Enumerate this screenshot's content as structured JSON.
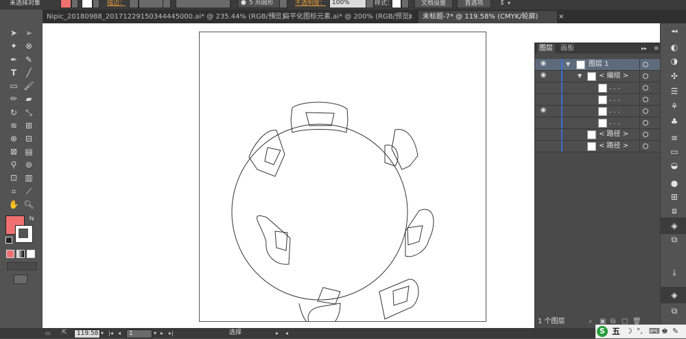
{
  "control_bar": {
    "selection_status": "未选择对象",
    "stroke_label": "描边：",
    "brush_label": "5 点圆形",
    "opacity_label": "不透明度：",
    "opacity_value": "100%",
    "style_label": "样式：",
    "doc_setup_button": "文档设置",
    "prefs_button": "首选项",
    "fill_color": "#f07070"
  },
  "tabs": [
    {
      "label": "Nipic_20180988_20171229150344445000.ai* @ 235.44% (RGB/预览)",
      "close": "×"
    },
    {
      "label": "扁平化图标元素.ai* @ 200% (RGB/预览)",
      "close": "×"
    },
    {
      "label": "未标题-7* @ 119.58% (CMYK/轮廓)",
      "close": "×"
    }
  ],
  "layers_panel": {
    "tab_layers": "图层",
    "tab_artboards": "画板",
    "menu_glyph": "▸▸",
    "rows": [
      {
        "name": "图层 1"
      },
      {
        "name": "< 编组 >"
      },
      {
        "name": ". . ."
      },
      {
        "name": ". . ."
      },
      {
        "name": ". . ."
      },
      {
        "name": ". . ."
      },
      {
        "name": "< 路径 >"
      },
      {
        "name": "< 路径 >"
      }
    ],
    "footer_count": "1 个图层"
  },
  "status_bar": {
    "zoom": "119.58",
    "page": "1",
    "tool_name": "选择"
  },
  "ime": {
    "label": "五"
  },
  "icons": {
    "selection": "selection-arrow-icon",
    "direct_selection": "direct-selection-icon",
    "magic_wand": "magic-wand-icon",
    "lasso": "lasso-icon",
    "pen": "pen-icon",
    "type": "type-icon",
    "line": "line-segment-icon",
    "rectangle": "rectangle-icon",
    "paintbrush": "paintbrush-icon",
    "pencil": "pencil-icon",
    "eraser": "eraser-icon",
    "rotate": "rotate-icon",
    "scale": "scale-icon",
    "eyedropper": "eyedropper-icon",
    "hand": "hand-icon",
    "zoom": "zoom-icon"
  }
}
